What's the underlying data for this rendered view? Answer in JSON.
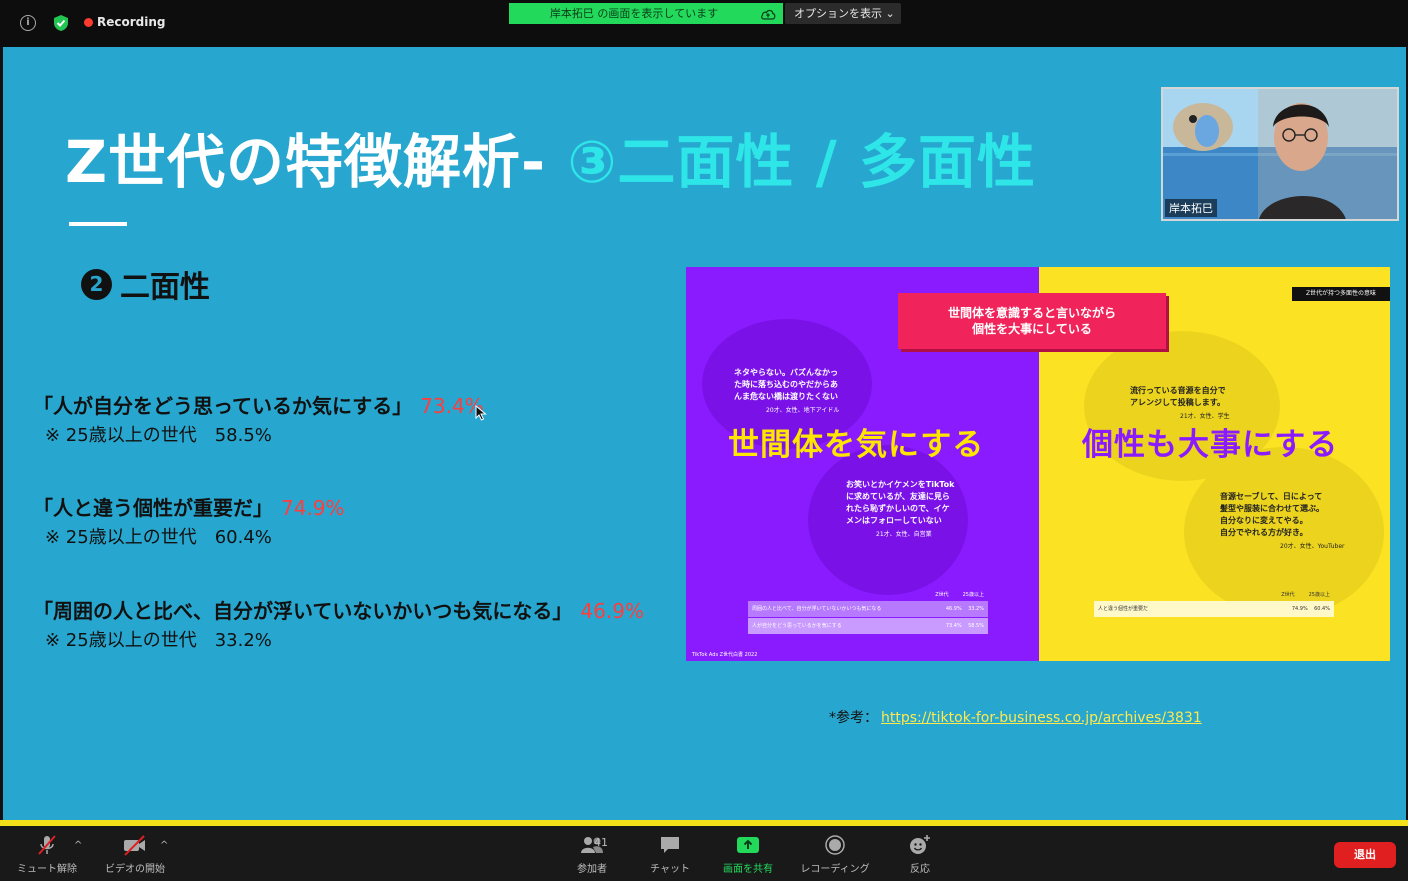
{
  "topbar": {
    "recording_label": "Recording",
    "share_banner": "岸本拓巳 の画面を表示しています",
    "options_label": "オプションを表示 ⌄"
  },
  "slide": {
    "title_white": "Z世代の特徴解析- ",
    "title_cyan": "③二面性 / 多面性",
    "section_number": "2",
    "section_label": "二面性",
    "stats": [
      {
        "text": "「人が自分をどう思っているか気にする」",
        "pct": "73.4%",
        "sub": "※ 25歳以上の世代　58.5%"
      },
      {
        "text": "「人と違う個性が重要だ」",
        "pct": "74.9%",
        "sub": "※ 25歳以上の世代　60.4%"
      },
      {
        "text": "「周囲の人と比べ、自分が浮いていないかいつも気になる」",
        "pct": "46.9%",
        "sub": "※ 25歳以上の世代　33.2%"
      }
    ],
    "reference_prefix": "*参考：",
    "reference_link": "https://tiktok-for-business.co.jp/archives/3831"
  },
  "thumbnail": {
    "pink_box_line1": "世間体を意識すると言いながら",
    "pink_box_line2": "個性を大事にしている",
    "tag": "Z世代が持つ多面性の意味",
    "big_left": "世間体を気にする",
    "big_right": "個性も大事にする",
    "quote1_line1": "ネタやらない。バズんなかっ",
    "quote1_line2": "た時に落ち込むのやだからあ",
    "quote1_line3": "んま危ない橋は渡りたくない",
    "quote1_meta": "20才、女性、地下アイドル",
    "quote2_line1": "お笑いとかイケメンをTikTok",
    "quote2_line2": "に求めているが、友達に見ら",
    "quote2_line3": "れたら恥ずかしいので、イケ",
    "quote2_line4": "メンはフォローしていない",
    "quote2_meta": "21才、女性、自営業",
    "quote3_line1": "流行っている音源を自分で",
    "quote3_line2": "アレンジして投稿します。",
    "quote3_meta": "21才、女性、学生",
    "quote4_line1": "音源セーブして、日によって",
    "quote4_line2": "髪型や服装に合わせて選ぶ。",
    "quote4_line3": "自分なりに変えてやる。",
    "quote4_line4": "自分でやれる方が好き。",
    "quote4_meta": "20才、女性、YouTuber",
    "table_left_head1": "Z世代",
    "table_left_head2": "25歳以上",
    "table_left_row1": "周囲の人と比べて、自分が浮いていないかいつも気になる",
    "table_left_row1_a": "46.9%",
    "table_left_row1_b": "33.2%",
    "table_left_row2": "人が自分をどう思っているかを気にする",
    "table_left_row2_a": "73.4%",
    "table_left_row2_b": "58.5%",
    "table_right_head1": "Z世代",
    "table_right_head2": "25歳以上",
    "table_right_row1": "人と違う個性が重要だ",
    "table_right_row1_a": "74.9%",
    "table_right_row1_b": "60.4%",
    "footer": "TikTok Ads Z世代白書 2022"
  },
  "video": {
    "participant_name": "岸本拓巳"
  },
  "toolbar": {
    "mute_label": "ミュート解除",
    "video_label": "ビデオの開始",
    "participants_label": "参加者",
    "participants_count": "41",
    "chat_label": "チャット",
    "share_label": "画面を共有",
    "record_label": "レコーディング",
    "reactions_label": "反応",
    "leave_label": "退出"
  },
  "colors": {
    "slide_bg": "#27a7cf",
    "title_cyan": "#2ee6e8",
    "pct_red": "#ff3d3d",
    "share_green": "#23d95c",
    "leave_red": "#e02020"
  }
}
